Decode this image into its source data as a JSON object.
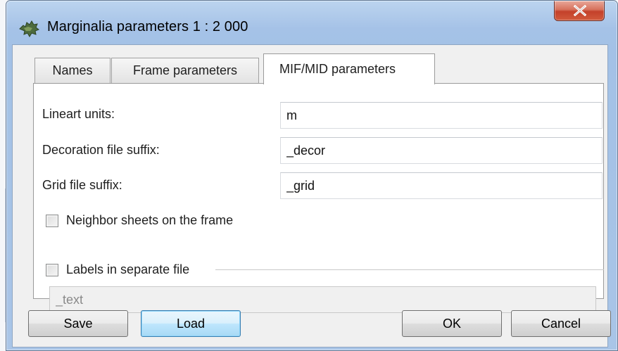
{
  "window": {
    "title": "Marginalia parameters 1 : 2 000",
    "close_symbol": "X",
    "accent_colors": {
      "close": "#c4412a",
      "frame": "#a5c2e7",
      "default_button": "#3c7fb1"
    }
  },
  "tabs": [
    {
      "label": "Names",
      "active": false
    },
    {
      "label": "Frame parameters",
      "active": false
    },
    {
      "label": "MIF/MID parameters",
      "active": true
    }
  ],
  "form": {
    "lineart_units": {
      "label": "Lineart units:",
      "value": "m"
    },
    "decoration_suffix": {
      "label": "Decoration file suffix:",
      "value": "_decor"
    },
    "grid_suffix": {
      "label": "Grid file suffix:",
      "value": "_grid"
    },
    "neighbor_sheets": {
      "label": "Neighbor sheets on the frame",
      "checked": false
    },
    "labels_separate": {
      "label": "Labels in separate file",
      "checked": false
    },
    "labels_suffix": {
      "value": "_text",
      "disabled": true
    }
  },
  "buttons": {
    "save": "Save",
    "load": "Load",
    "ok": "OK",
    "cancel": "Cancel"
  },
  "icons": {
    "app": "map-leaf-icon",
    "close": "close-icon"
  }
}
